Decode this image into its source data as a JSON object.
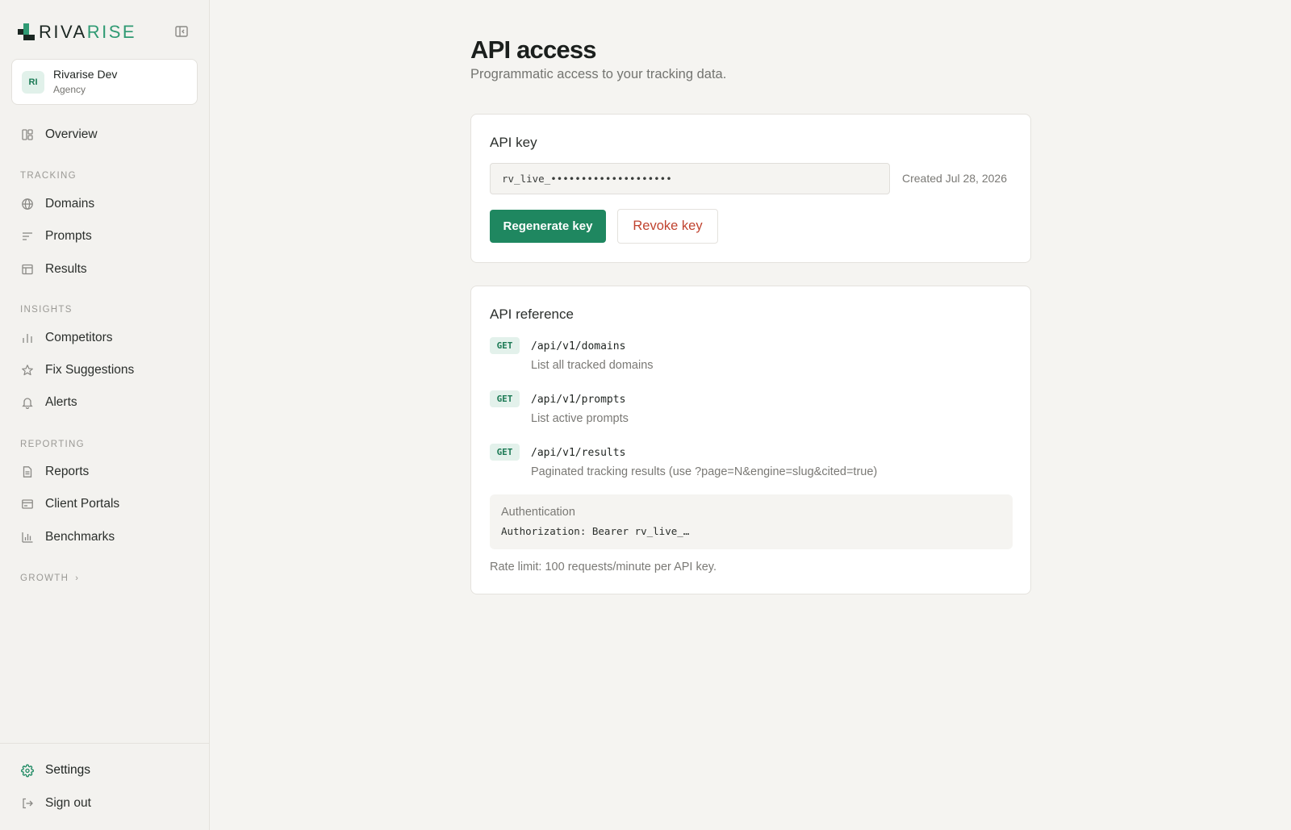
{
  "brand": {
    "name_part1": "RIVA",
    "name_part2": "RISE",
    "accent": "#2f9a73"
  },
  "workspace": {
    "initials": "RI",
    "name": "Rivarise Dev",
    "type": "Agency"
  },
  "sidebar": {
    "overview": "Overview",
    "sections": {
      "tracking": "TRACKING",
      "insights": "INSIGHTS",
      "reporting": "REPORTING",
      "growth": "GROWTH"
    },
    "tracking": {
      "domains": "Domains",
      "prompts": "Prompts",
      "results": "Results"
    },
    "insights": {
      "competitors": "Competitors",
      "fix_suggestions": "Fix Suggestions",
      "alerts": "Alerts"
    },
    "reporting": {
      "reports": "Reports",
      "client_portals": "Client Portals",
      "benchmarks": "Benchmarks"
    },
    "growth_chevron": "›",
    "settings": "Settings",
    "sign_out": "Sign out"
  },
  "page": {
    "title": "API access",
    "subtitle": "Programmatic access to your tracking data."
  },
  "api_key_card": {
    "title": "API key",
    "key_value": "rv_live_••••••••••••••••••••",
    "created": "Created Jul 28, 2026",
    "regenerate_label": "Regenerate key",
    "revoke_label": "Revoke key"
  },
  "api_reference": {
    "title": "API reference",
    "endpoints": [
      {
        "method": "GET",
        "path": "/api/v1/domains",
        "description": "List all tracked domains"
      },
      {
        "method": "GET",
        "path": "/api/v1/prompts",
        "description": "List active prompts"
      },
      {
        "method": "GET",
        "path": "/api/v1/results",
        "description": "Paginated tracking results (use ?page=N&engine=slug&cited=true)"
      }
    ],
    "auth_title": "Authentication",
    "auth_code": "Authorization: Bearer rv_live_…",
    "rate_limit": "Rate limit: 100 requests/minute per API key."
  }
}
